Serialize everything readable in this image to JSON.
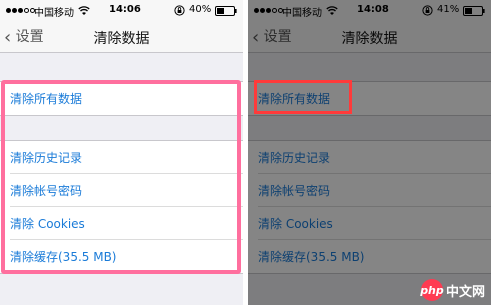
{
  "left": {
    "status": {
      "carrier": "中国移动",
      "time": "14:06",
      "battery": "40%"
    },
    "nav": {
      "back": "设置",
      "title": "清除数据"
    },
    "items": [
      "清除所有数据",
      "清除历史记录",
      "清除帐号密码",
      "清除 Cookies",
      "清除缓存(35.5 MB)"
    ]
  },
  "right": {
    "status": {
      "carrier": "中国移动",
      "time": "14:08",
      "battery": "41%"
    },
    "nav": {
      "back": "设置",
      "title": "清除数据"
    },
    "items": [
      "清除所有数据",
      "清除历史记录",
      "清除帐号密码",
      "清除 Cookies",
      "清除缓存(35.5 MB)"
    ]
  },
  "watermark": {
    "logo": "php",
    "text": "中文网"
  },
  "colors": {
    "link": "#1a7bd8",
    "highlight_left": "#ff6f9e",
    "highlight_right": "#ff3a3a"
  },
  "icons": [
    "signal-dots-icon",
    "wifi-icon",
    "rotation-lock-icon",
    "battery-icon",
    "back-chevron-icon"
  ]
}
